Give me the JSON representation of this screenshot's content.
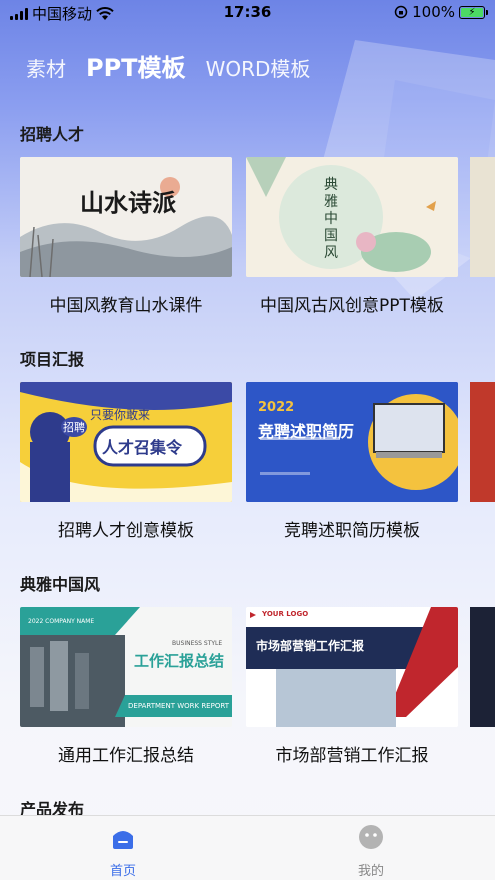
{
  "status": {
    "carrier": "中国移动",
    "time": "17:36",
    "battery": "100%"
  },
  "tabs": [
    {
      "label": "素材"
    },
    {
      "label": "PPT模板"
    },
    {
      "label": "WORD模板"
    }
  ],
  "sections": [
    {
      "title": "招聘人才",
      "cards": [
        {
          "label": "中国风教育山水课件",
          "thumb_text": "山水诗派"
        },
        {
          "label": "中国风古风创意PPT模板",
          "thumb_text": "典雅中国风"
        }
      ]
    },
    {
      "title": "项目汇报",
      "cards": [
        {
          "label": "招聘人才创意模板",
          "thumb_text": "人才召集令",
          "thumb_sub": "只要你敢来",
          "thumb_badge": "招聘"
        },
        {
          "label": "竞聘述职简历模板",
          "thumb_text": "竞聘述职简历",
          "thumb_year": "2022"
        }
      ]
    },
    {
      "title": "典雅中国风",
      "cards": [
        {
          "label": "通用工作汇报总结",
          "thumb_text": "工作汇报总结",
          "thumb_company": "2022 COMPANY NAME",
          "thumb_style": "BUSINESS STYLE",
          "thumb_footer": "DEPARTMENT WORK REPORT"
        },
        {
          "label": "市场部营销工作汇报",
          "thumb_text": "市场部营销工作汇报",
          "thumb_logo": "YOUR LOGO"
        }
      ]
    },
    {
      "title": "产品发布"
    }
  ],
  "nav": [
    {
      "label": "首页",
      "active": true,
      "color": "#3b6ee8"
    },
    {
      "label": "我的",
      "active": false,
      "color": "#888888"
    }
  ]
}
